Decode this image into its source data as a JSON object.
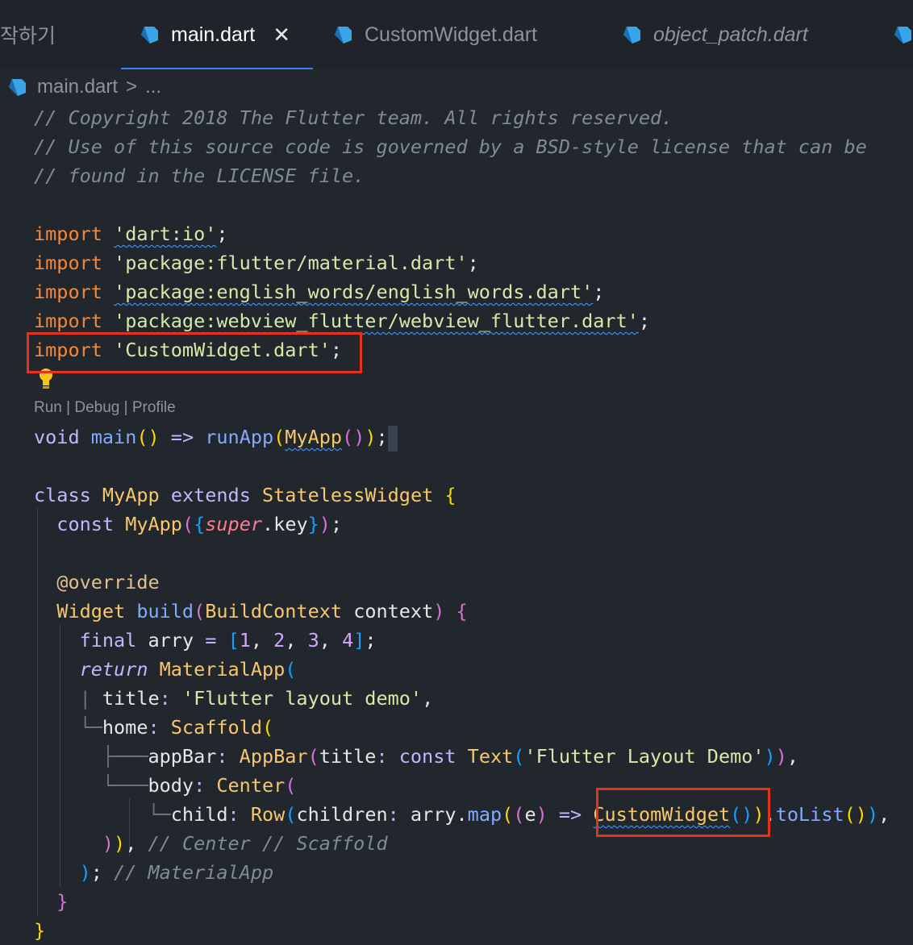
{
  "tabs": [
    {
      "label": "작하기",
      "active": false
    },
    {
      "label": "main.dart",
      "active": true,
      "close": "✕"
    },
    {
      "label": "CustomWidget.dart",
      "active": false
    },
    {
      "label": "object_patch.dart",
      "active": false,
      "italic": true
    }
  ],
  "breadcrumb": {
    "file": "main.dart",
    "sep": ">",
    "more": "..."
  },
  "code": {
    "comments": [
      "// Copyright 2018 The Flutter team. All rights reserved.",
      "// Use of this source code is governed by a BSD-style license that can be",
      "// found in the LICENSE file."
    ],
    "import_kw": "import",
    "imports": [
      "'dart:io'",
      "'package:flutter/material.dart'",
      "'package:english_words/english_words.dart'",
      "'package:webview_flutter/webview_flutter.dart'",
      "'CustomWidget.dart'"
    ],
    "codelens": {
      "run": "Run",
      "debug": "Debug",
      "profile": "Profile",
      "divider": " | "
    },
    "main_line": {
      "void": "void",
      "main": "main",
      "arrow": "=>",
      "runApp": "runApp",
      "myapp": "MyApp"
    },
    "class_line": {
      "class": "class",
      "name": "MyApp",
      "extends": "extends",
      "parent": "StatelessWidget"
    },
    "ctor": {
      "const": "const",
      "name": "MyApp",
      "super": "super",
      "key": "key"
    },
    "override": "@override",
    "build": {
      "type": "Widget",
      "name": "build",
      "param_type": "BuildContext",
      "param": "context"
    },
    "arry": {
      "final": "final",
      "name": "arry",
      "values": [
        "1",
        "2",
        "3",
        "4"
      ]
    },
    "ret": {
      "return": "return",
      "name": "MaterialApp"
    },
    "title_line": {
      "key": "title",
      "value": "'Flutter layout demo'"
    },
    "home_line": {
      "key": "home",
      "value": "Scaffold"
    },
    "appbar_line": {
      "key": "appBar",
      "cls": "AppBar",
      "title": "title",
      "const": "const",
      "text": "Text",
      "str": "'Flutter Layout Demo'"
    },
    "body_line": {
      "key": "body",
      "value": "Center"
    },
    "child_line": {
      "key": "child",
      "row": "Row",
      "children": "children",
      "arry": "arry",
      "map": "map",
      "e": "e",
      "arrow": "=>",
      "custom": "CustomWidget",
      "tolist": "toList"
    },
    "close_hints": {
      "center": "// Center",
      "scaffold": "// Scaffold",
      "material": "// MaterialApp"
    }
  }
}
